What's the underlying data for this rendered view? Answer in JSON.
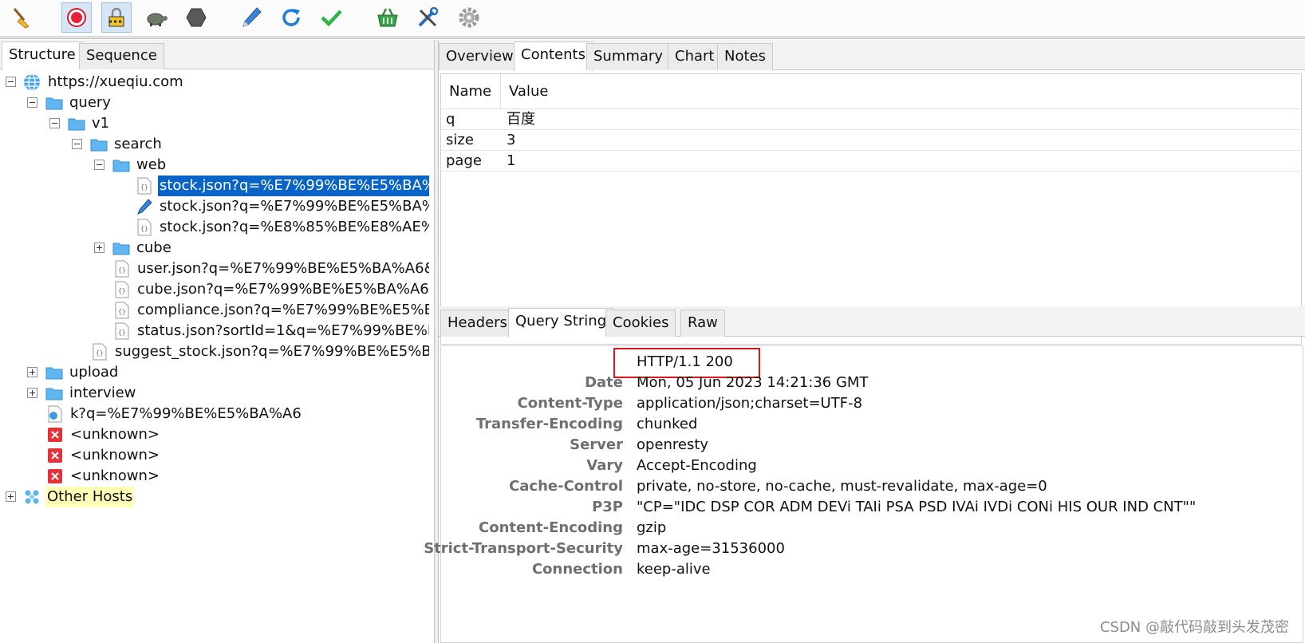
{
  "toolbar": {
    "buttons": [
      {
        "name": "clear-session-icon"
      },
      {
        "name": "record-icon"
      },
      {
        "name": "ssl-lock-icon"
      },
      {
        "name": "throttle-turtle-icon"
      },
      {
        "name": "stop-hexagon-icon"
      },
      {
        "name": "edit-pen-icon"
      },
      {
        "name": "repeat-icon"
      },
      {
        "name": "validate-check-icon"
      },
      {
        "name": "basket-icon"
      },
      {
        "name": "tools-icon"
      },
      {
        "name": "settings-gear-icon"
      }
    ]
  },
  "left": {
    "tabs": [
      "Structure",
      "Sequence"
    ],
    "tree": [
      {
        "label": "https://xueqiu.com"
      },
      {
        "label": "query"
      },
      {
        "label": "v1"
      },
      {
        "label": "search"
      },
      {
        "label": "web"
      },
      {
        "label": "stock.json?q=%E7%99%BE%E5%BA%A"
      },
      {
        "label": "stock.json?q=%E7%99%BE%E5%BA%A"
      },
      {
        "label": "stock.json?q=%E8%85%BE%E8%AE%A"
      },
      {
        "label": "cube"
      },
      {
        "label": "user.json?q=%E7%99%BE%E5%BA%A6&c"
      },
      {
        "label": "cube.json?q=%E7%99%BE%E5%BA%A6&c"
      },
      {
        "label": "compliance.json?q=%E7%99%BE%E5%BA%"
      },
      {
        "label": "status.json?sortId=1&q=%E7%99%BE%E5"
      },
      {
        "label": "suggest_stock.json?q=%E7%99%BE%E5%BA%"
      },
      {
        "label": "upload"
      },
      {
        "label": "interview"
      },
      {
        "label": "k?q=%E7%99%BE%E5%BA%A6"
      },
      {
        "label": "<unknown>"
      },
      {
        "label": "<unknown>"
      },
      {
        "label": "<unknown>"
      },
      {
        "label": "Other Hosts"
      }
    ]
  },
  "right": {
    "top_tabs": [
      "Overview",
      "Contents",
      "Summary",
      "Chart",
      "Notes"
    ],
    "grid": {
      "columns": [
        "Name",
        "Value"
      ],
      "rows": [
        {
          "name": "q",
          "value": "百度"
        },
        {
          "name": "size",
          "value": "3"
        },
        {
          "name": "page",
          "value": "1"
        }
      ]
    },
    "mid_tabs": [
      "Headers",
      "Query String",
      "Cookies",
      "Raw"
    ],
    "headers": [
      {
        "key": "",
        "value": "HTTP/1.1 200"
      },
      {
        "key": "Date",
        "value": "Mon, 05 Jun 2023 14:21:36 GMT"
      },
      {
        "key": "Content-Type",
        "value": "application/json;charset=UTF-8"
      },
      {
        "key": "Transfer-Encoding",
        "value": "chunked"
      },
      {
        "key": "Server",
        "value": "openresty"
      },
      {
        "key": "Vary",
        "value": "Accept-Encoding"
      },
      {
        "key": "Cache-Control",
        "value": "private, no-store, no-cache, must-revalidate, max-age=0"
      },
      {
        "key": "P3P",
        "value": "\"CP=\"IDC DSP COR ADM DEVi TAIi PSA PSD IVAi IVDi CONi HIS OUR IND CNT\"\""
      },
      {
        "key": "Content-Encoding",
        "value": "gzip"
      },
      {
        "key": "Strict-Transport-Security",
        "value": "max-age=31536000"
      },
      {
        "key": "Connection",
        "value": "keep-alive"
      }
    ]
  },
  "watermark": "CSDN @敲代码敲到头发茂密"
}
